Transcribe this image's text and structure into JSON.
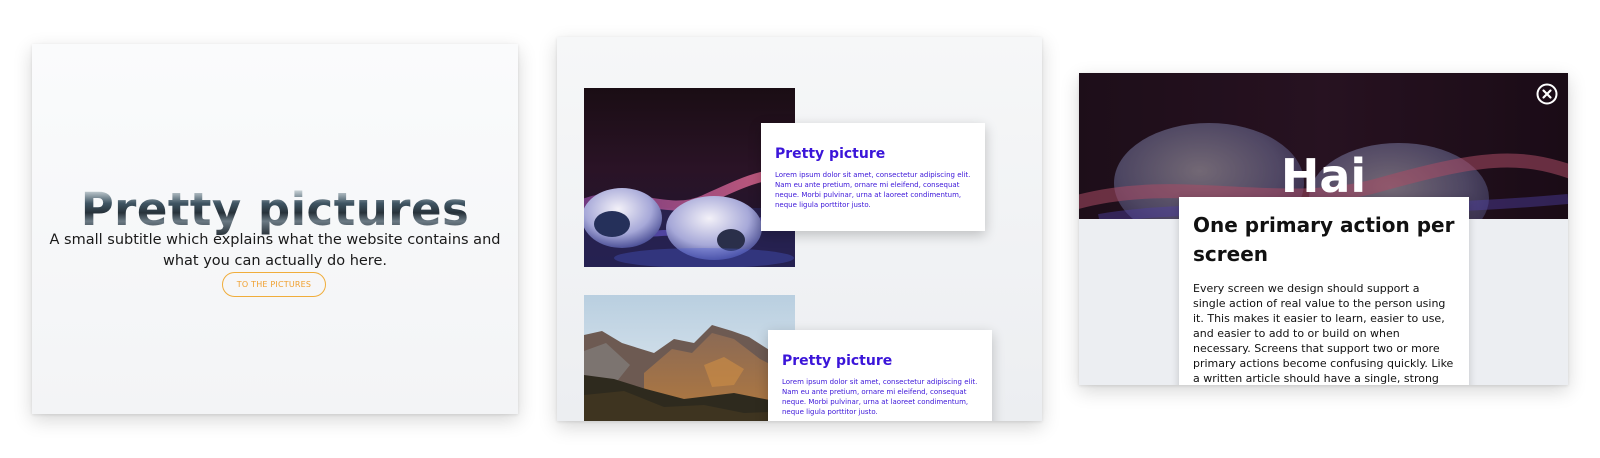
{
  "hero": {
    "title": "Pretty pictures",
    "subtitle": "A small subtitle which explains what the website contains and what you can actually do here.",
    "button_label": "TO THE PICTURES"
  },
  "cards": [
    {
      "title": "Pretty picture",
      "text": "Lorem ipsum dolor sit amet, consectetur adipiscing elit. Nam eu ante pretium, ornare mi eleifend, consequat neque. Morbi pulvinar, urna at laoreet condimentum, neque ligula porttitor justo."
    },
    {
      "title": "Pretty picture",
      "text": "Lorem ipsum dolor sit amet, consectetur adipiscing elit. Nam eu ante pretium, ornare mi eleifend, consequat neque. Morbi pulvinar, urna at laoreet condimentum, neque ligula porttitor justo."
    }
  ],
  "modal": {
    "heading": "Hai",
    "card_title": "One primary action per screen",
    "card_text": "Every screen we design should support a single action of real value to the person using it. This makes it easier to learn, easier to use, and easier to add to or build on when necessary. Screens that support two or more primary actions become confusing quickly. Like a written article should have a single, strong thesis, every screen we design should support a single, strong action that is its raison d'etre."
  },
  "colors": {
    "accent_orange": "#f0ad3c",
    "card_text_blue": "#3b15d9"
  },
  "icons": {
    "close": "close-circle-icon"
  }
}
